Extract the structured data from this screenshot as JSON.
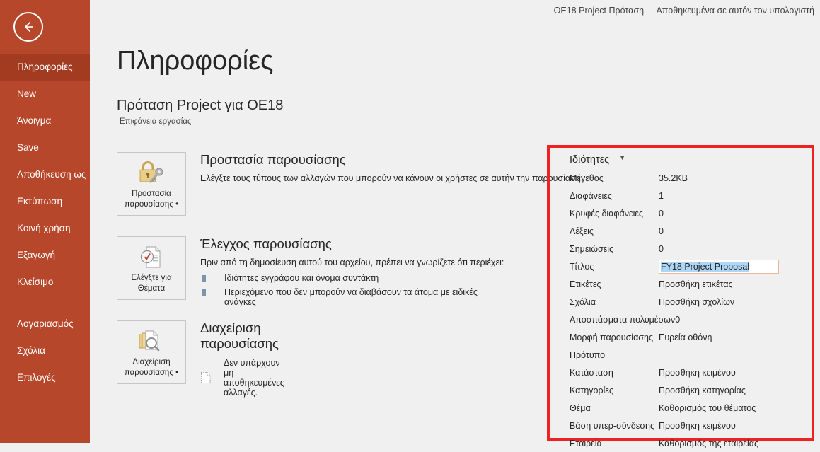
{
  "titlebar": {
    "document": "OE18 Project Πρόταση",
    "separator": "-",
    "location": "Αποθηκευμένα σε αυτόν τον υπολογιστή"
  },
  "rail": {
    "back_icon": "back-arrow-icon",
    "items": [
      {
        "label": "Πληροφορίες",
        "active": true
      },
      {
        "label": "New",
        "active": false
      },
      {
        "label": "Άνοιγμα",
        "active": false
      },
      {
        "label": "Save",
        "active": false
      },
      {
        "label": "Αποθήκευση ως",
        "active": false
      },
      {
        "label": "Εκτύπωση",
        "active": false
      },
      {
        "label": "Κοινή χρήση",
        "active": false
      },
      {
        "label": "Εξαγωγή",
        "active": false
      },
      {
        "label": "Κλείσιμο",
        "active": false
      }
    ],
    "items_bottom": [
      {
        "label": "Λογαριασμός"
      },
      {
        "label": "Σχόλια"
      },
      {
        "label": "Επιλογές"
      }
    ]
  },
  "page": {
    "title": "Πληροφορίες",
    "doc_name": "Πρόταση Project για OE18",
    "doc_path": "Επιφάνεια εργασίας"
  },
  "sections": [
    {
      "button_label_line1": "Προστασία",
      "button_label_line2": "παρουσίασης •",
      "icon": "lock-key-icon",
      "title": "Προστασία παρουσίασης",
      "desc": "Ελέγξτε τους τύπους των αλλαγών που μπορούν να κάνουν οι χρήστες σε αυτήν την παρουσίαση."
    },
    {
      "button_label_line1": "Ελέγξτε για",
      "button_label_line2": "Θέματα",
      "icon": "document-inspect-icon",
      "title": "Έλεγχος παρουσίασης",
      "desc": "Πριν από τη δημοσίευση αυτού του αρχείου, πρέπει να γνωρίζετε ότι περιέχει:",
      "bullets": [
        "Ιδιότητες εγγράφου και όνομα συντάκτη",
        "Περιεχόμενο που δεν μπορούν να διαβάσουν τα άτομα με ειδικές ανάγκες"
      ]
    },
    {
      "button_label_line1": "Διαχείριση",
      "button_label_line2": "παρουσίασης •",
      "icon": "manage-versions-icon",
      "title": "Διαχείριση παρουσίασης",
      "status_icon": "unsaved-document-icon",
      "status": "Δεν υπάρχουν μη αποθηκευμένες αλλαγές."
    }
  ],
  "properties": {
    "heading": "Ιδιότητες",
    "caret_icon": "chevron-down-icon",
    "rows": [
      {
        "key": "Μέγεθος",
        "value": "35.2KB"
      },
      {
        "key": "Διαφάνειες",
        "value": "1"
      },
      {
        "key": "Κρυφές διαφάνειες",
        "value": "0"
      },
      {
        "key": "Λέξεις",
        "value": "0"
      },
      {
        "key": "Σημειώσεις",
        "value": "0"
      },
      {
        "key": "Ετικέτες",
        "value": "Προσθήκη ετικέτας"
      },
      {
        "key": "Σχόλια",
        "value": "Προσθήκη σχολίων"
      },
      {
        "key": "Αποσπάσματα πολυμέσων",
        "value": "0"
      },
      {
        "key": "Μορφή παρουσίασης",
        "value": "Ευρεία οθόνη"
      },
      {
        "key": "Πρότυπο",
        "value": ""
      },
      {
        "key": "Κατάσταση",
        "value": "Προσθήκη κειμένου"
      },
      {
        "key": "Κατηγορίες",
        "value": "Προσθήκη κατηγορίας"
      },
      {
        "key": "Θέμα",
        "value": "Καθορισμός του θέματος"
      },
      {
        "key": "Βάση υπερ-σύνδεσης",
        "value": "Προσθήκη κειμένου"
      },
      {
        "key": "Εταιρεία",
        "value": "Καθορισμός της εταιρείας"
      }
    ],
    "title_field": {
      "key": "Τίτλος",
      "value": "FY18 Project Proposal"
    }
  },
  "colors": {
    "rail": "#b7472a",
    "rail_active": "#a23b20",
    "highlight_border": "#ee2222",
    "selection": "#add6f7",
    "field_border": "#e8b998"
  }
}
